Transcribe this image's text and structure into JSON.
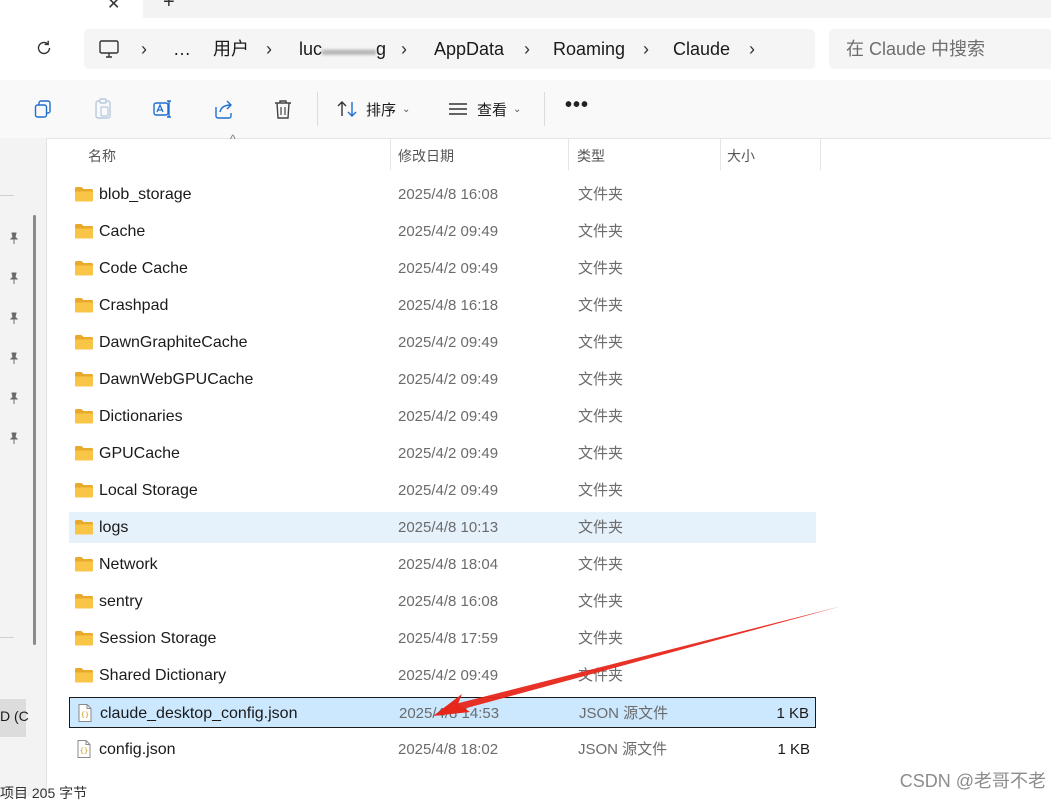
{
  "window": {
    "new_tab_glyph": "+",
    "close_tab_glyph": "✕"
  },
  "address": {
    "overflow": "…",
    "crumbs": [
      "用户",
      "luc",
      "g",
      "AppData",
      "Roaming",
      "Claude"
    ],
    "separator": "›"
  },
  "search": {
    "placeholder": "在 Claude 中搜索"
  },
  "toolbar": {
    "sort_label": "排序",
    "view_label": "查看",
    "more_label": "•••"
  },
  "columns": {
    "name": "名称",
    "date": "修改日期",
    "type": "类型",
    "size": "大小"
  },
  "files": [
    {
      "name": "blob_storage",
      "date": "2025/4/8 16:08",
      "type": "文件夹",
      "size": "",
      "kind": "folder"
    },
    {
      "name": "Cache",
      "date": "2025/4/2 09:49",
      "type": "文件夹",
      "size": "",
      "kind": "folder"
    },
    {
      "name": "Code Cache",
      "date": "2025/4/2 09:49",
      "type": "文件夹",
      "size": "",
      "kind": "folder"
    },
    {
      "name": "Crashpad",
      "date": "2025/4/8 16:18",
      "type": "文件夹",
      "size": "",
      "kind": "folder"
    },
    {
      "name": "DawnGraphiteCache",
      "date": "2025/4/2 09:49",
      "type": "文件夹",
      "size": "",
      "kind": "folder"
    },
    {
      "name": "DawnWebGPUCache",
      "date": "2025/4/2 09:49",
      "type": "文件夹",
      "size": "",
      "kind": "folder"
    },
    {
      "name": "Dictionaries",
      "date": "2025/4/2 09:49",
      "type": "文件夹",
      "size": "",
      "kind": "folder"
    },
    {
      "name": "GPUCache",
      "date": "2025/4/2 09:49",
      "type": "文件夹",
      "size": "",
      "kind": "folder"
    },
    {
      "name": "Local Storage",
      "date": "2025/4/2 09:49",
      "type": "文件夹",
      "size": "",
      "kind": "folder"
    },
    {
      "name": "logs",
      "date": "2025/4/8 10:13",
      "type": "文件夹",
      "size": "",
      "kind": "folder"
    },
    {
      "name": "Network",
      "date": "2025/4/8 18:04",
      "type": "文件夹",
      "size": "",
      "kind": "folder"
    },
    {
      "name": "sentry",
      "date": "2025/4/8 16:08",
      "type": "文件夹",
      "size": "",
      "kind": "folder"
    },
    {
      "name": "Session Storage",
      "date": "2025/4/8 17:59",
      "type": "文件夹",
      "size": "",
      "kind": "folder"
    },
    {
      "name": "Shared Dictionary",
      "date": "2025/4/2 09:49",
      "type": "文件夹",
      "size": "",
      "kind": "folder"
    },
    {
      "name": "claude_desktop_config.json",
      "date": "2025/4/8 14:53",
      "type": "JSON 源文件",
      "size": "1 KB",
      "kind": "json"
    },
    {
      "name": "config.json",
      "date": "2025/4/8 18:02",
      "type": "JSON 源文件",
      "size": "1 KB",
      "kind": "json"
    }
  ],
  "left_pane": {
    "selected_label": "D (C"
  },
  "status": {
    "text": "项目 205 字节"
  },
  "watermark": "CSDN @老哥不老",
  "colors": {
    "folder": "#f8c547",
    "folder_dark": "#e9a92a",
    "selection": "#cce8ff",
    "hover": "#e5f1fb",
    "annotation_arrow": "#e8271b"
  }
}
